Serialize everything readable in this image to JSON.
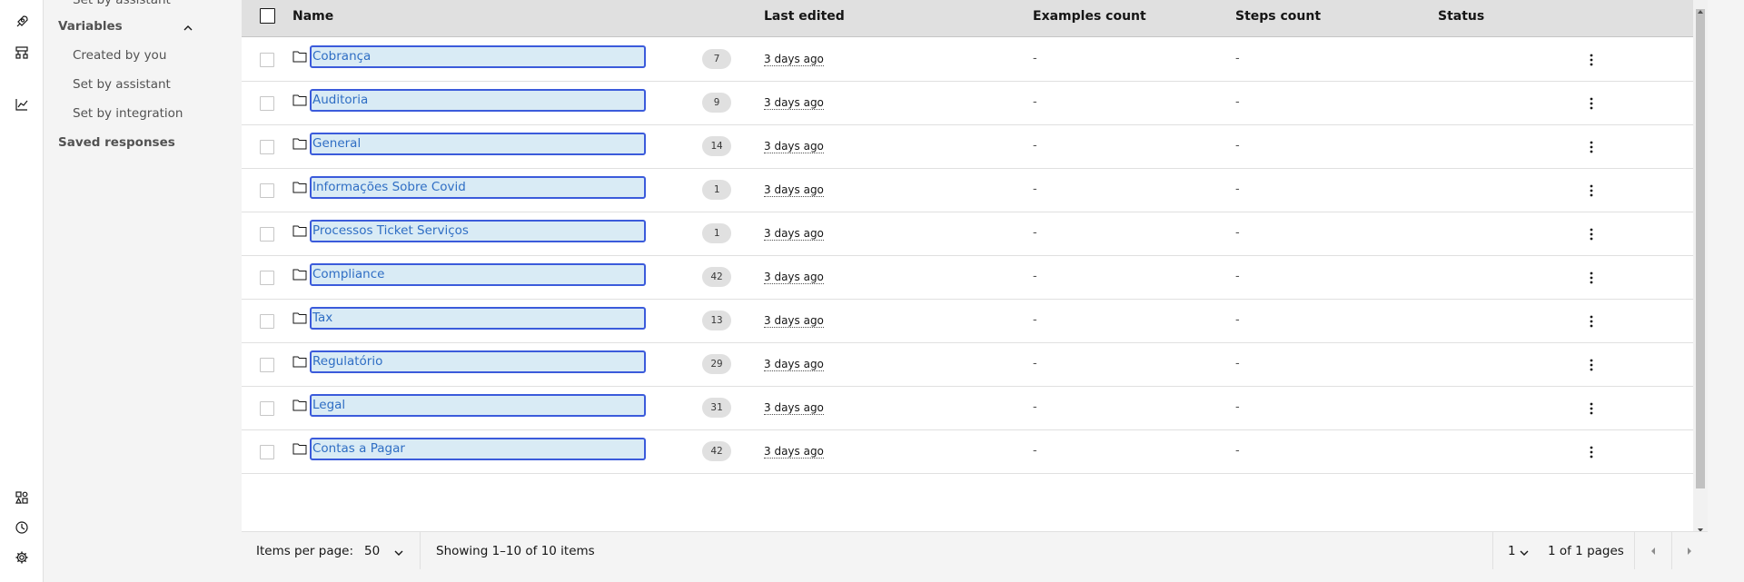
{
  "sidebar": {
    "items": [
      {
        "label": "Set by assistant"
      },
      {
        "label": "Variables"
      },
      {
        "label": "Created by you"
      },
      {
        "label": "Set by assistant"
      },
      {
        "label": "Set by integration"
      },
      {
        "label": "Saved responses"
      }
    ]
  },
  "rail_icons": [
    "rocket-icon",
    "flowchart-icon",
    "analytics-icon",
    "integrations-icon",
    "history-icon",
    "settings-icon"
  ],
  "table": {
    "columns": [
      "Name",
      "Last edited",
      "Examples count",
      "Steps count",
      "Status"
    ],
    "rows": [
      {
        "name": "Cobrança",
        "count": "7",
        "edited": "3 days ago",
        "examples": "-",
        "steps": "-"
      },
      {
        "name": "Auditoria",
        "count": "9",
        "edited": "3 days ago",
        "examples": "-",
        "steps": "-"
      },
      {
        "name": "General",
        "count": "14",
        "edited": "3 days ago",
        "examples": "-",
        "steps": "-"
      },
      {
        "name": "Informações Sobre Covid",
        "count": "1",
        "edited": "3 days ago",
        "examples": "-",
        "steps": "-"
      },
      {
        "name": "Processos Ticket Serviços",
        "count": "1",
        "edited": "3 days ago",
        "examples": "-",
        "steps": "-"
      },
      {
        "name": "Compliance",
        "count": "42",
        "edited": "3 days ago",
        "examples": "-",
        "steps": "-"
      },
      {
        "name": "Tax",
        "count": "13",
        "edited": "3 days ago",
        "examples": "-",
        "steps": "-"
      },
      {
        "name": "Regulatório",
        "count": "29",
        "edited": "3 days ago",
        "examples": "-",
        "steps": "-"
      },
      {
        "name": "Legal",
        "count": "31",
        "edited": "3 days ago",
        "examples": "-",
        "steps": "-"
      },
      {
        "name": "Contas a Pagar",
        "count": "42",
        "edited": "3 days ago",
        "examples": "-",
        "steps": "-"
      }
    ]
  },
  "pagination": {
    "items_per_page_label": "Items per page:",
    "items_per_page_value": "50",
    "showing": "Showing 1–10 of 10 items",
    "page_value": "1",
    "page_total": "1 of 1 pages"
  },
  "colors": {
    "accent": "#3b5bdb",
    "link": "#2f6ec4",
    "name_highlight": "#d9ebf5"
  }
}
